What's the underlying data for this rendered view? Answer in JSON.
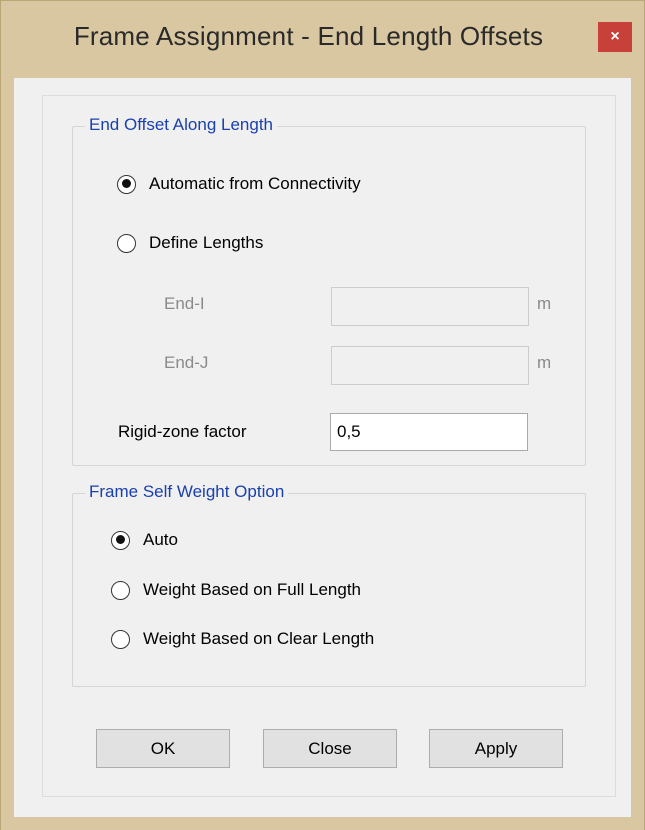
{
  "window": {
    "title": "Frame Assignment - End Length Offsets",
    "close_glyph": "×",
    "accent_close": "#c7403a",
    "frame_color": "#d8c7a0"
  },
  "end_offset": {
    "legend": "End Offset Along Length",
    "options": [
      {
        "label": "Automatic from Connectivity",
        "checked": true
      },
      {
        "label": "Define Lengths",
        "checked": false
      }
    ],
    "end_i": {
      "label": "End-I",
      "value": "",
      "unit": "m"
    },
    "end_j": {
      "label": "End-J",
      "value": "",
      "unit": "m"
    },
    "rigid_zone": {
      "label": "Rigid-zone factor",
      "value": "0,5"
    }
  },
  "self_weight": {
    "legend": "Frame Self Weight Option",
    "options": [
      {
        "label": "Auto",
        "checked": true
      },
      {
        "label": "Weight Based on Full Length",
        "checked": false
      },
      {
        "label": "Weight Based on Clear Length",
        "checked": false
      }
    ]
  },
  "buttons": {
    "ok": "OK",
    "close": "Close",
    "apply": "Apply"
  }
}
